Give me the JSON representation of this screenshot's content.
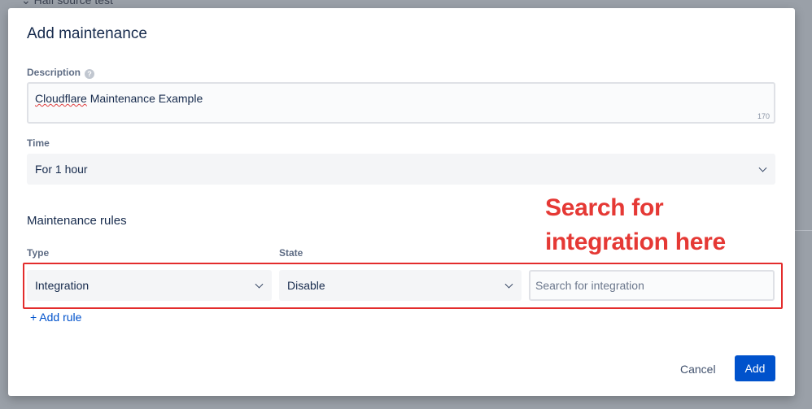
{
  "background": {
    "partial_text": "Half source test"
  },
  "dialog": {
    "title": "Add maintenance",
    "description": {
      "label": "Description",
      "value_word1": "Cloudflare",
      "value_rest": " Maintenance Example",
      "char_counter": "170"
    },
    "time": {
      "label": "Time",
      "selected": "For 1 hour"
    },
    "rules": {
      "section_title": "Maintenance rules",
      "type_label": "Type",
      "state_label": "State",
      "type_selected": "Integration",
      "state_selected": "Disable",
      "search_placeholder": "Search for integration",
      "add_rule_label": "+ Add rule"
    },
    "annotation": {
      "line1": "Search for",
      "line2": "integration here",
      "color": "#e53935"
    },
    "buttons": {
      "cancel": "Cancel",
      "add": "Add"
    }
  },
  "colors": {
    "primary": "#0052cc",
    "highlight_box": "#e32c2c"
  }
}
